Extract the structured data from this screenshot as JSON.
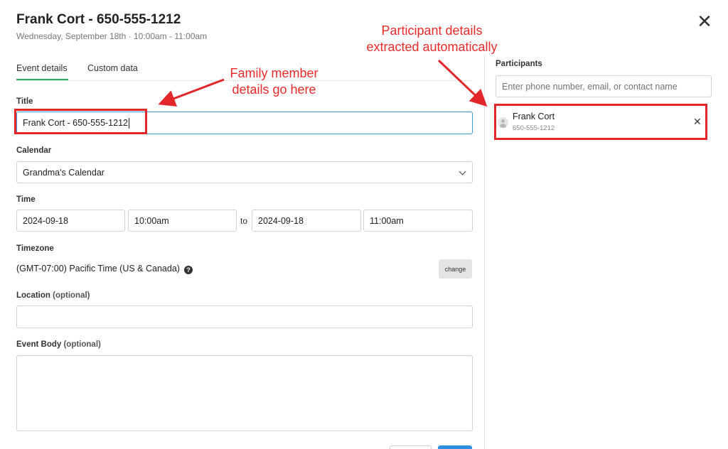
{
  "header": {
    "title": "Frank Cort - 650-555-1212",
    "subtitle": "Wednesday, September 18th · 10:00am - 11:00am",
    "close_label": "✕"
  },
  "tabs": [
    {
      "label": "Event details",
      "active": true
    },
    {
      "label": "Custom data",
      "active": false
    }
  ],
  "form": {
    "title_label": "Title",
    "title_value": "Frank Cort - 650-555-1212",
    "calendar_label": "Calendar",
    "calendar_value": "Grandma's Calendar",
    "time_label": "Time",
    "start_date": "2024-09-18",
    "start_time": "10:00am",
    "to_label": "to",
    "end_date": "2024-09-18",
    "end_time": "11:00am",
    "timezone_label": "Timezone",
    "timezone_value": "(GMT-07:00) Pacific Time (US & Canada)",
    "timezone_help": "?",
    "change_label": "change",
    "location_label": "Location",
    "location_optional": "(optional)",
    "location_value": "",
    "body_label": "Event Body",
    "body_optional": "(optional)",
    "body_value": ""
  },
  "participants": {
    "label": "Participants",
    "placeholder": "Enter phone number, email, or contact name",
    "items": [
      {
        "name": "Frank Cort",
        "phone": "650-555-1212",
        "remove": "✕"
      }
    ]
  },
  "annotations": {
    "family": [
      "Family member",
      "details go here"
    ],
    "participant": [
      "Participant details",
      "extracted automatically"
    ],
    "color": "#e3262a"
  },
  "colors": {
    "accent_green": "#27ae60",
    "focus_blue": "#3b9ad9"
  }
}
